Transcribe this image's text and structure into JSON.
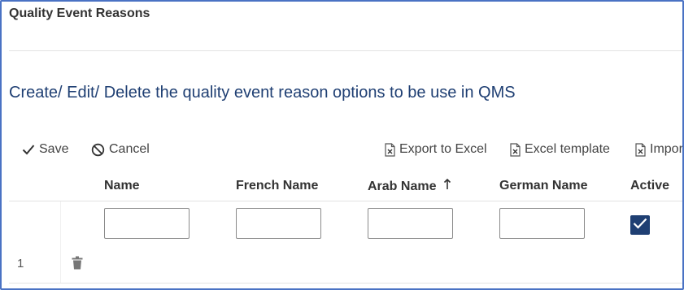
{
  "panel": {
    "title": "Quality Event Reasons",
    "subtitle": "Create/ Edit/ Delete the quality event reason options to be use in QMS"
  },
  "toolbar": {
    "save_label": "Save",
    "cancel_label": "Cancel",
    "export_label": "Export to Excel",
    "template_label": "Excel template",
    "import_label": "Impor"
  },
  "table": {
    "columns": {
      "name": "Name",
      "french_name": "French Name",
      "arab_name": "Arab Name",
      "german_name": "German Name",
      "active": "Active"
    },
    "sort": {
      "column": "Arab Name",
      "direction": "ascending",
      "icon": "arrow-up-icon"
    },
    "rows": [
      {
        "number": "1",
        "name": "",
        "french_name": "",
        "arab_name": "",
        "german_name": "",
        "active": true
      }
    ]
  },
  "colors": {
    "accent": "#1f3f73",
    "frame_border": "#4a72c4",
    "text": "#333333"
  },
  "icons": {
    "save": "checkmark-icon",
    "cancel": "cancel-circle-icon",
    "export": "excel-file-icon",
    "template": "excel-file-icon",
    "import": "excel-file-icon",
    "delete": "trash-icon"
  }
}
